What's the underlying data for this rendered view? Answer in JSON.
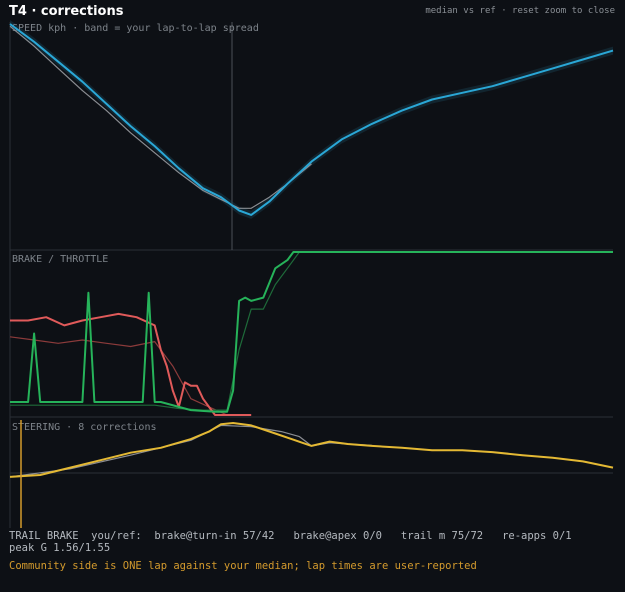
{
  "header": {
    "title": "T4 · corrections",
    "hint": "median vs ref · reset zoom to close"
  },
  "panels": {
    "speed_label": "SPEED kph · band = your lap-to-lap spread",
    "brake_label": "BRAKE / THROTTLE",
    "steer_label": "STEERING · 8 corrections"
  },
  "footer": {
    "line1": "TRAIL BRAKE  you/ref:  brake@turn-in 57/42   brake@apex 0/0   trail m 75/72   re-apps 0/1",
    "line2": "peak G 1.56/1.55",
    "note": "Community side is ONE lap against your median; lap times are user-reported"
  },
  "colors": {
    "speed_you": "#2aa7d6",
    "speed_ref": "#8a8d92",
    "brake_you": "#e05a5a",
    "brake_ref": "#8c3b3b",
    "throttle_you": "#26b35a",
    "throttle_ref": "#1e6b3a",
    "steer_you": "#e4b934",
    "steer_ref": "#8a8d92",
    "marker": "#d39a2d"
  },
  "chart_data": [
    {
      "type": "line",
      "panel": "speed",
      "x_range": [
        0,
        100
      ],
      "y_range": [
        0,
        100
      ],
      "grid": false,
      "series": [
        {
          "values_x": [
            0,
            4,
            8,
            12,
            16,
            20,
            24,
            28,
            32,
            35,
            38,
            40,
            43,
            46,
            50,
            55,
            60,
            65,
            70,
            75,
            80,
            85,
            90,
            95,
            100
          ],
          "values_y": [
            100,
            92,
            83,
            74,
            64,
            54,
            45,
            35,
            26,
            22,
            16,
            14,
            20,
            28,
            38,
            48,
            55,
            61,
            66,
            69,
            72,
            76,
            80,
            84,
            88
          ]
        },
        {
          "values_x": [
            0,
            4,
            8,
            12,
            16,
            20,
            24,
            28,
            32,
            35,
            38,
            40,
            43,
            46,
            50
          ],
          "values_y": [
            99,
            90,
            80,
            70,
            61,
            51,
            42,
            33,
            25,
            21,
            17,
            17,
            22,
            28,
            37
          ]
        }
      ]
    },
    {
      "type": "line",
      "panel": "brake_throttle",
      "x_range": [
        0,
        100
      ],
      "y_range": [
        0,
        100
      ],
      "series": [
        {
          "values_x": [
            0,
            3,
            6,
            9,
            12,
            15,
            18,
            21,
            24,
            25,
            26,
            27,
            28,
            29,
            30,
            31,
            32,
            33,
            34,
            35,
            36,
            38,
            40
          ],
          "values_y": [
            58,
            58,
            60,
            55,
            58,
            60,
            62,
            60,
            55,
            40,
            30,
            15,
            5,
            20,
            18,
            18,
            10,
            5,
            0,
            0,
            0,
            0,
            0
          ]
        },
        {
          "values_x": [
            0,
            4,
            8,
            12,
            16,
            20,
            24,
            27,
            30,
            33,
            36
          ],
          "values_y": [
            48,
            46,
            44,
            46,
            44,
            42,
            45,
            30,
            10,
            5,
            0
          ]
        },
        {
          "values_x": [
            0,
            3,
            4,
            5,
            6,
            10,
            12,
            13,
            14,
            16,
            20,
            22,
            23,
            24,
            25,
            28,
            30,
            34,
            36,
            37,
            38,
            39,
            40,
            42,
            44,
            46,
            47,
            48,
            100
          ],
          "values_y": [
            8,
            8,
            50,
            8,
            8,
            8,
            8,
            75,
            8,
            8,
            8,
            8,
            75,
            8,
            8,
            5,
            3,
            2,
            2,
            15,
            70,
            72,
            70,
            72,
            90,
            95,
            100,
            100,
            100
          ]
        },
        {
          "values_x": [
            0,
            4,
            8,
            12,
            16,
            20,
            24,
            28,
            32,
            36,
            38,
            40,
            42,
            44,
            46,
            48
          ],
          "values_y": [
            6,
            6,
            6,
            6,
            6,
            6,
            6,
            4,
            3,
            3,
            40,
            65,
            65,
            80,
            90,
            100
          ]
        }
      ]
    },
    {
      "type": "line",
      "panel": "steering",
      "x_range": [
        0,
        100
      ],
      "y_range": [
        0,
        100
      ],
      "series": [
        {
          "values_x": [
            0,
            5,
            10,
            15,
            20,
            25,
            30,
            33,
            35,
            37,
            40,
            44,
            47,
            50,
            53,
            56,
            60,
            65,
            70,
            75,
            80,
            85,
            90,
            95,
            100
          ],
          "values_y": [
            5,
            8,
            20,
            32,
            44,
            52,
            66,
            78,
            90,
            92,
            88,
            75,
            65,
            55,
            62,
            58,
            55,
            52,
            48,
            48,
            45,
            40,
            36,
            30,
            20
          ]
        },
        {
          "values_x": [
            0,
            10,
            20,
            30,
            35,
            40,
            45,
            48,
            50,
            53,
            56,
            60
          ],
          "values_y": [
            5,
            18,
            40,
            64,
            88,
            86,
            78,
            70,
            55,
            60,
            58,
            56
          ]
        }
      ]
    }
  ]
}
